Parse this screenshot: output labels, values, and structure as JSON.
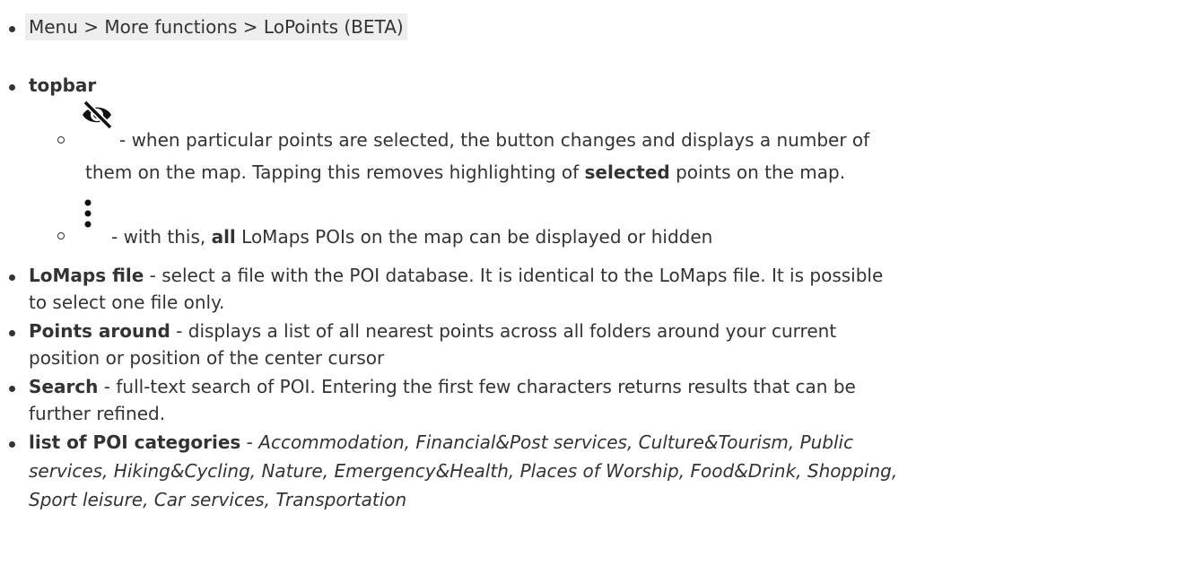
{
  "breadcrumb": "Menu > More functions > LoPoints (BETA)",
  "topbar": {
    "title": "topbar",
    "hide_item": {
      "icon": "eye-off-icon",
      "text_line1": " - when particular points are selected, the button changes and displays a number of",
      "text_line2_a": "them on the map. Tapping this removes highlighting of ",
      "text_line2_bold": "selected",
      "text_line2_b": " points on the map."
    },
    "menu_item": {
      "icon": "more-vertical-icon",
      "text_a": " - with this, ",
      "text_bold": "all",
      "text_b": " LoMaps POIs on the map can be displayed or hidden"
    }
  },
  "items": {
    "lomaps_file": {
      "term": "LoMaps file",
      "line1": " - select a file with the POI database. It is identical to the LoMaps file. It is possible",
      "line2": "to select one file only."
    },
    "points_around": {
      "term": "Points around",
      "line1": " - displays a list of all nearest points across all folders around your current",
      "line2": "position or position of the center cursor"
    },
    "search": {
      "term": "Search",
      "line1": " - full-text search of POI. Entering the first few characters returns results that can be",
      "line2": "further refined."
    },
    "poi_categories": {
      "term": "list of POI categories",
      "dash": " - ",
      "line1": "Accommodation, Financial&Post services, Culture&Tourism, Public",
      "line2": "services, Hiking&Cycling, Nature, Emergency&Health, Places of Worship, Food&Drink, Shopping,",
      "line3": "Sport leisure, Car services, Transportation"
    }
  }
}
